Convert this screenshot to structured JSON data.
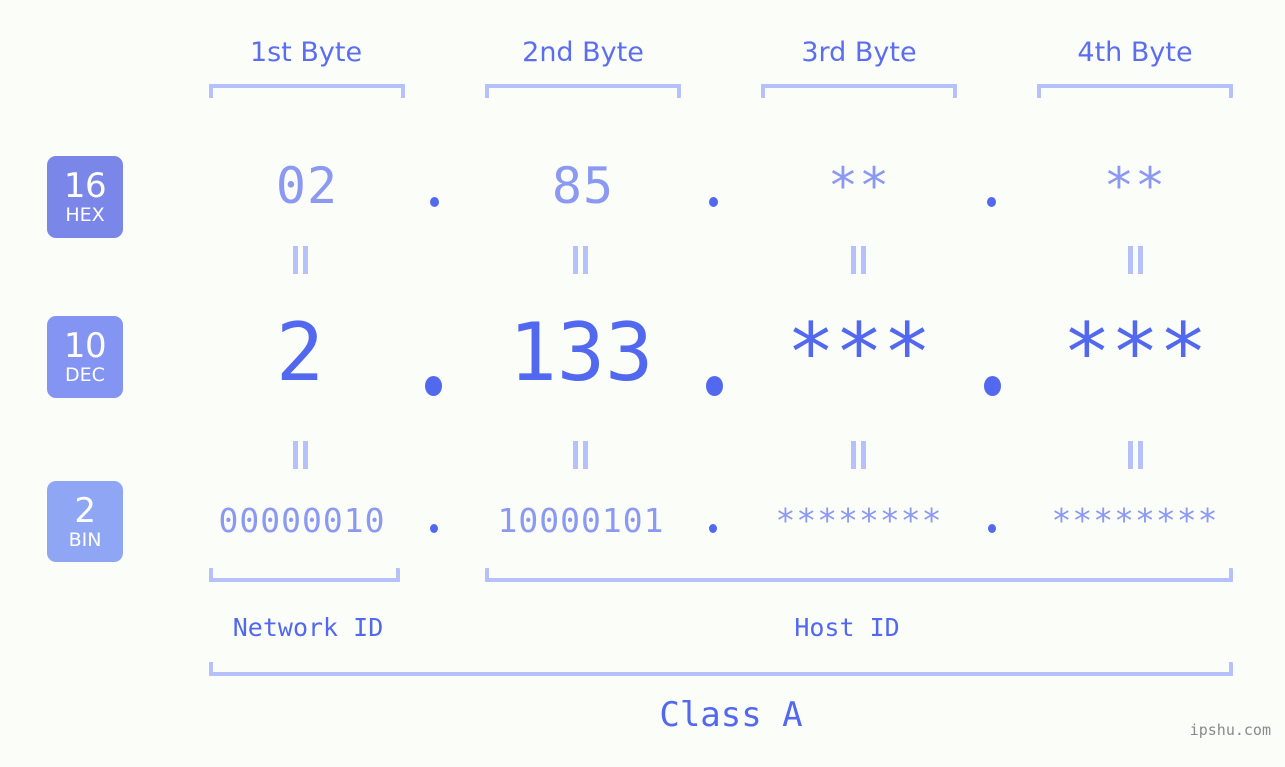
{
  "meta": {
    "watermark": "ipshu.com",
    "background_color": "#fbfdf8",
    "accent_color": "#5268ef",
    "light_accent_color": "#8c99f2",
    "bracket_color": "#b6c0fb"
  },
  "headers": [
    {
      "label": "1st Byte"
    },
    {
      "label": "2nd Byte"
    },
    {
      "label": "3rd Byte"
    },
    {
      "label": "4th Byte"
    }
  ],
  "bases": [
    {
      "number": "16",
      "name": "HEX",
      "color": "#7a87e8"
    },
    {
      "number": "10",
      "name": "DEC",
      "color": "#8494f2"
    },
    {
      "number": "2",
      "name": "BIN",
      "color": "#8fa6f5"
    }
  ],
  "rows": {
    "hex": {
      "base": "16",
      "base_name": "HEX",
      "values": [
        "02",
        "85",
        "**",
        "**"
      ]
    },
    "dec": {
      "base": "10",
      "base_name": "DEC",
      "values": [
        "2",
        "133",
        "***",
        "***"
      ]
    },
    "bin": {
      "base": "2",
      "base_name": "BIN",
      "values": [
        "00000010",
        "10000101",
        "********",
        "********"
      ]
    }
  },
  "separator": ".",
  "equals_marker": "=",
  "segments": {
    "network_id": "Network ID",
    "host_id": "Host ID"
  },
  "class": {
    "label": "Class A"
  }
}
